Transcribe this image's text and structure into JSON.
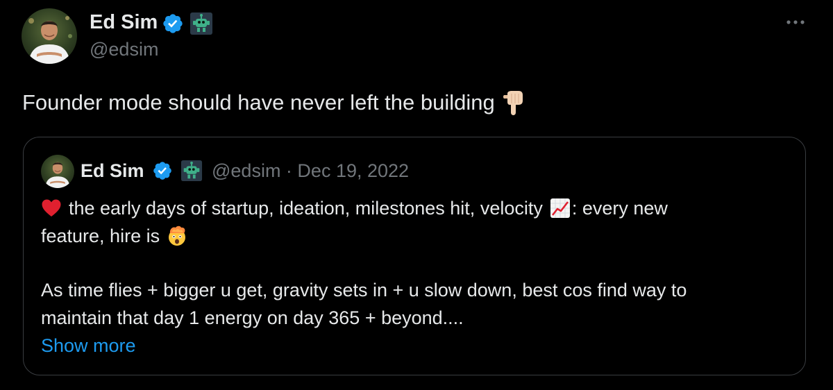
{
  "author": {
    "name": "Ed Sim",
    "handle": "@edsim",
    "verified": true,
    "badge_icon": "robot-icon",
    "avatar_icon": "profile-photo"
  },
  "more_icon": "more-options-icon",
  "tweet": {
    "text": "Founder mode should have never left the building",
    "emoji": "backhand-index-pointing-down"
  },
  "quoted_tweet": {
    "author_name": "Ed Sim",
    "meta": "@edsim · Dec 19, 2022",
    "line1_a": "the early days of startup, ideation, milestones hit, velocity",
    "line1_b": ": every new",
    "line2": "feature, hire is",
    "line3": "As time flies + bigger u get, gravity sets in + u slow down, best cos find way to",
    "line4": "maintain that day 1 energy on day 365 + beyond....",
    "show_more": "Show more",
    "emojis": [
      "red-heart",
      "chart-increasing",
      "exploding-head"
    ]
  },
  "colors": {
    "background": "#000000",
    "text": "#e7e9ea",
    "secondary_text": "#71767b",
    "link": "#1d9bf0",
    "verified_badge": "#1d9bf0",
    "border": "#3a3d41"
  }
}
